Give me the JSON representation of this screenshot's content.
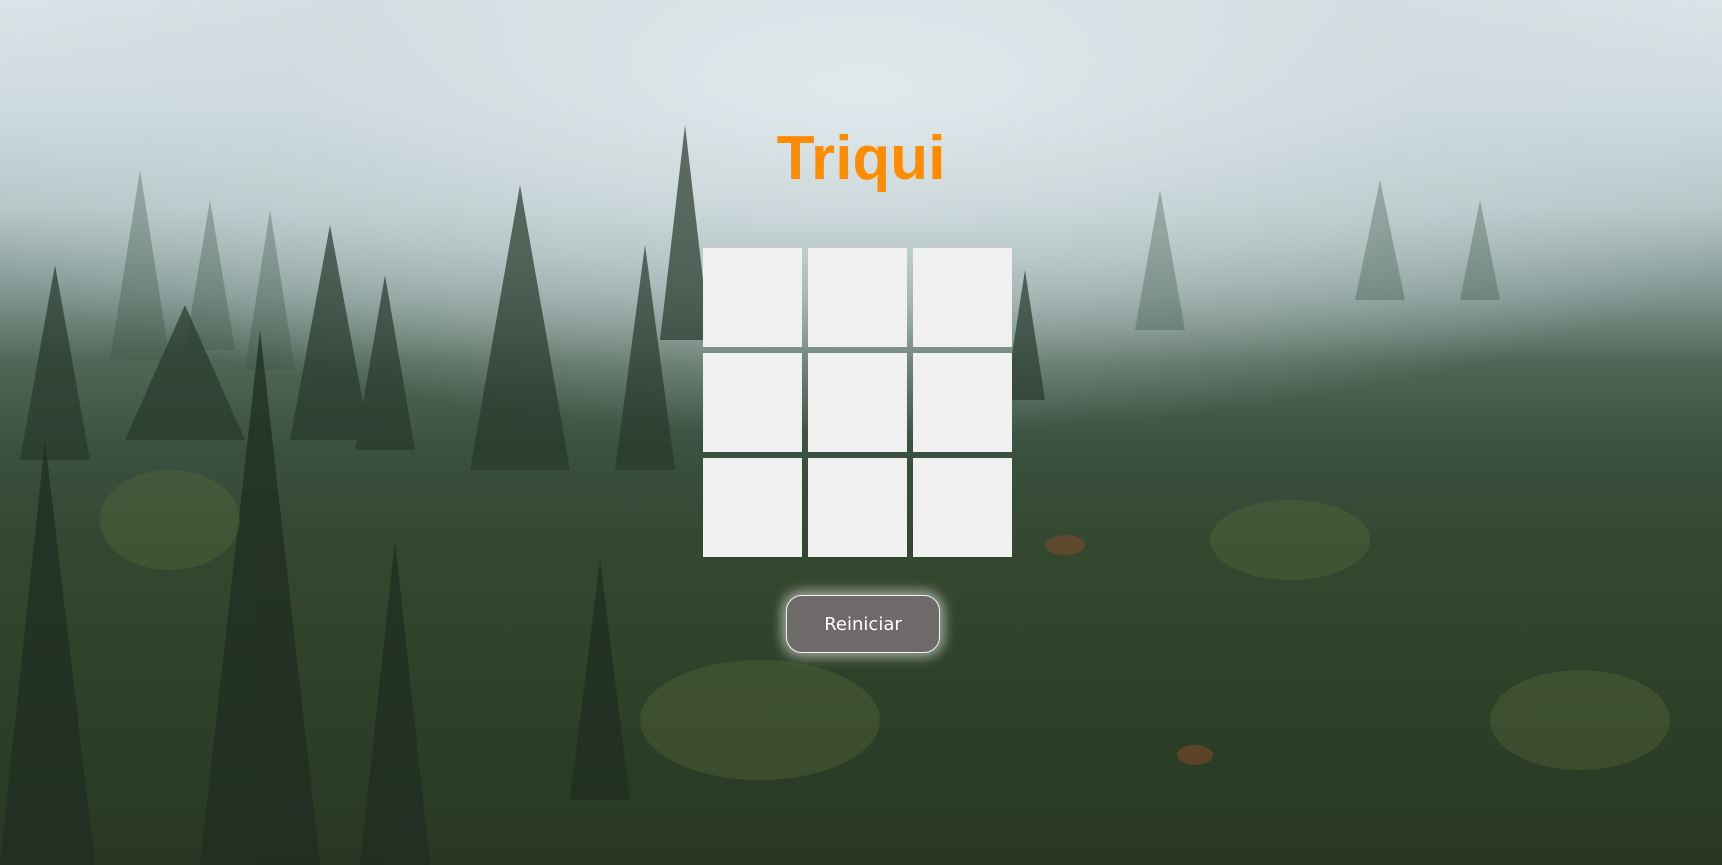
{
  "app": {
    "title": "Triqui"
  },
  "board": {
    "cells": [
      "",
      "",
      "",
      "",
      "",
      "",
      "",
      "",
      ""
    ]
  },
  "controls": {
    "reset_label": "Reiniciar"
  },
  "colors": {
    "title": "#ff8c00",
    "cell": "#f0f0f0",
    "reset_button": "#6e6a69"
  }
}
